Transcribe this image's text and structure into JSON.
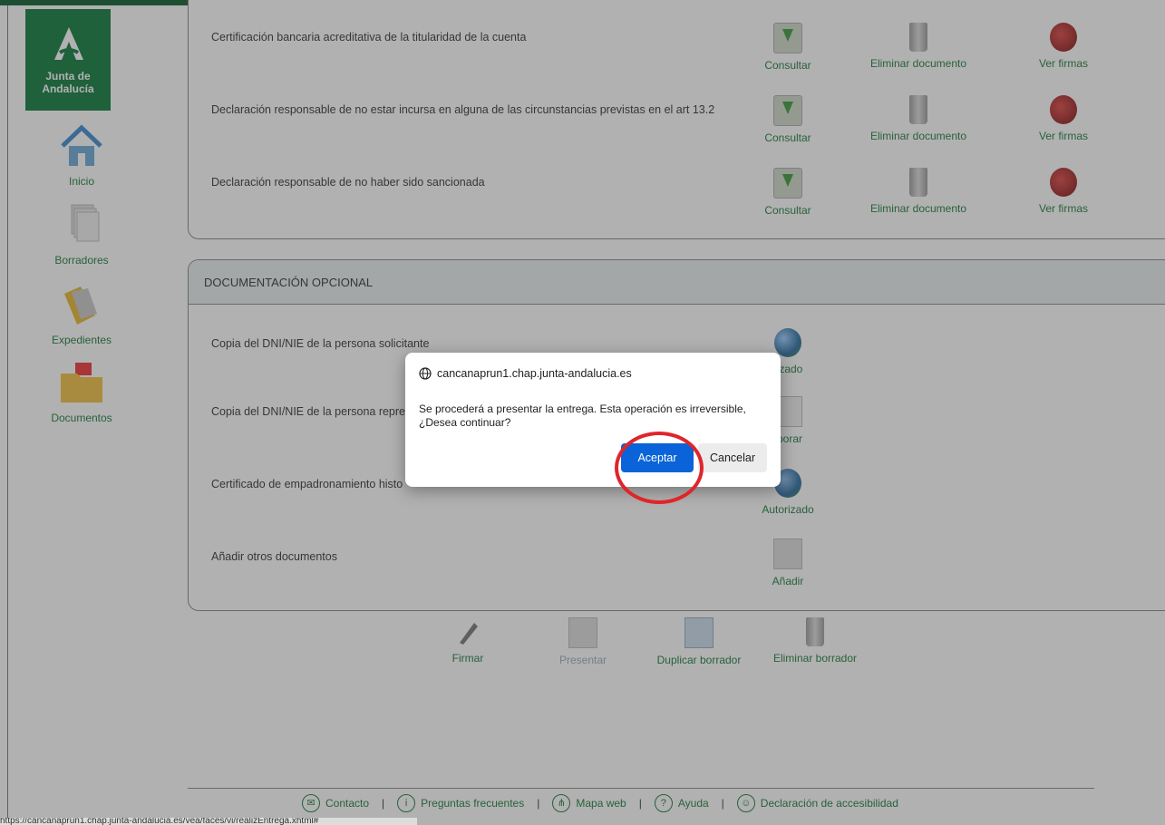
{
  "sidebar": {
    "logo_text": "Junta de Andalucía",
    "items": [
      {
        "label": "Inicio",
        "icon": "home-icon"
      },
      {
        "label": "Borradores",
        "icon": "drafts-icon"
      },
      {
        "label": "Expedientes",
        "icon": "folder-icon"
      },
      {
        "label": "Documentos",
        "icon": "pdf-folder-icon"
      }
    ]
  },
  "required_docs": [
    {
      "label": "Certificación bancaria acreditativa de la titularidad de la cuenta",
      "consult": "Consultar",
      "delete": "Eliminar documento",
      "signatures": "Ver firmas"
    },
    {
      "label": "Declaración responsable de no estar incursa en alguna de las circunstancias previstas en el art 13.2",
      "consult": "Consultar",
      "delete": "Eliminar documento",
      "signatures": "Ver firmas"
    },
    {
      "label": "Declaración responsable de no haber sido sancionada",
      "consult": "Consultar",
      "delete": "Eliminar documento",
      "signatures": "Ver firmas"
    }
  ],
  "optional_section": {
    "title": "DOCUMENTACIÓN OPCIONAL",
    "rows": [
      {
        "label": "Copia del DNI/NIE de la persona solicitante",
        "action": "rizado"
      },
      {
        "label": "Copia del DNI/NIE de la persona repre",
        "action": "rporar"
      },
      {
        "label": "Certificado de empadronamiento histo",
        "action": "Autorizado"
      },
      {
        "label": "Añadir otros documentos",
        "action": "Añadir"
      }
    ]
  },
  "bottom_actions": {
    "sign": "Firmar",
    "present": "Presentar",
    "duplicate": "Duplicar borrador",
    "delete_draft": "Eliminar borrador"
  },
  "dialog": {
    "origin": "cancanaprun1.chap.junta-andalucia.es",
    "message": "Se procederá a presentar la entrega. Esta operación es irreversible, ¿Desea continuar?",
    "ok": "Aceptar",
    "cancel": "Cancelar"
  },
  "footer": {
    "contact": "Contacto",
    "faq": "Preguntas frecuentes",
    "sitemap": "Mapa web",
    "help": "Ayuda",
    "accessibility": "Declaración de accesibilidad",
    "separator": "|"
  },
  "status_url": "https://cancanaprun1.chap.junta-andalucia.es/vea/faces/vi/realizEntrega.xhtml#",
  "colors": {
    "brand_green": "#0b7a3b",
    "link_green": "#1b7a3a",
    "primary_button": "#0a63d8",
    "highlight_ring": "#e0252a"
  }
}
